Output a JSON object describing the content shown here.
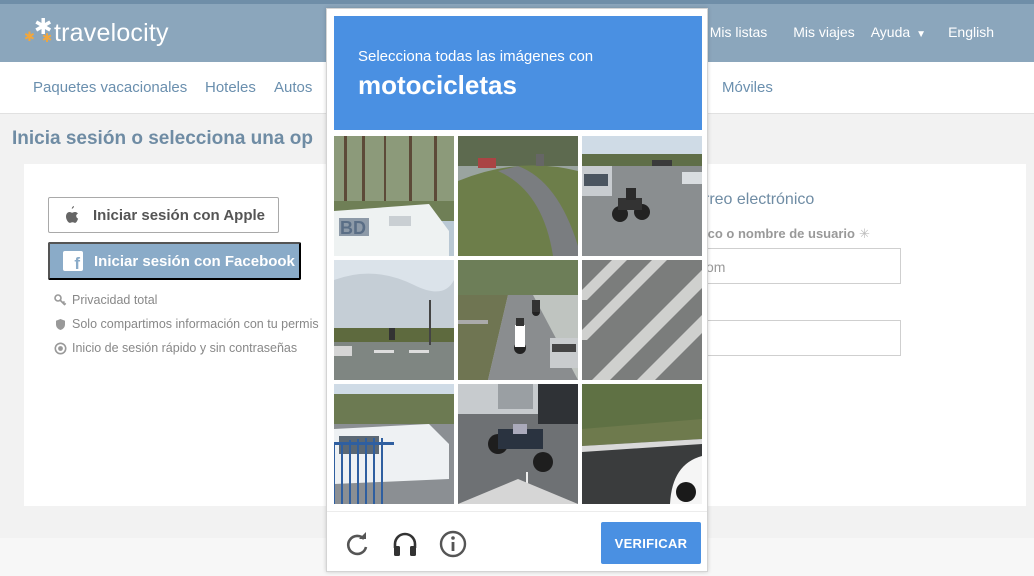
{
  "header": {
    "logo_text": "travelocity",
    "nav": [
      "Mis listas",
      "Mis viajes",
      "Ayuda",
      "English"
    ]
  },
  "subnav": {
    "items": [
      "Paquetes vacacionales",
      "Hoteles",
      "Autos"
    ],
    "right_item": "Móviles"
  },
  "page": {
    "title": "Inicia sesión o selecciona una op"
  },
  "login": {
    "apple_button": "Iniciar sesión con Apple",
    "facebook_button": "Iniciar sesión con Facebook",
    "features": [
      "Privacidad total",
      "Solo compartimos información con tu permis",
      "Inicio de sesión rápido y sin contraseñas"
    ],
    "email_section_title": "rreo electrónico",
    "email_label": "ico o nombre de usuario",
    "email_required_mark": "✳",
    "email_input_value": "om"
  },
  "captcha": {
    "instruction": "Selecciona todas las imágenes con",
    "target": "motocicletas",
    "verify_button": "VERIFICAR",
    "icons": [
      "reload-icon",
      "headphones-icon",
      "info-icon"
    ]
  },
  "colors": {
    "header_bg": "#8ba6bc",
    "captcha_blue": "#4a90e2",
    "facebook_button": "#8aabc8",
    "link_color": "#6a8fae"
  }
}
